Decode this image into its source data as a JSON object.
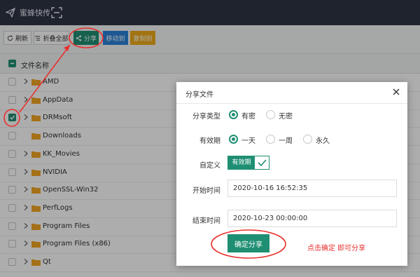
{
  "app": {
    "title": "蜜蜂快传"
  },
  "toolbar": {
    "refresh_label": "刷新",
    "collapse_label": "折叠全部",
    "share_label": "分享",
    "move_label": "移动到",
    "copy_label": "复制到"
  },
  "file_list": {
    "header": "文件名称",
    "rows": [
      {
        "name": "AMD",
        "checked": false,
        "expandable": true
      },
      {
        "name": "AppData",
        "checked": false,
        "expandable": true
      },
      {
        "name": "DRMsoft",
        "checked": true,
        "expandable": true
      },
      {
        "name": "Downloads",
        "checked": false,
        "expandable": false
      },
      {
        "name": "KK_Movies",
        "checked": false,
        "expandable": true
      },
      {
        "name": "NVIDIA",
        "checked": false,
        "expandable": true
      },
      {
        "name": "OpenSSL-Win32",
        "checked": false,
        "expandable": true
      },
      {
        "name": "PerfLogs",
        "checked": false,
        "expandable": true
      },
      {
        "name": "Program Files",
        "checked": false,
        "expandable": true
      },
      {
        "name": "Program Files (x86)",
        "checked": false,
        "expandable": true
      },
      {
        "name": "Qt",
        "checked": false,
        "expandable": true
      }
    ]
  },
  "dialog": {
    "title": "分享文件",
    "share_type": {
      "label": "分享类型",
      "options": [
        "有密",
        "无密"
      ],
      "selected": "有密"
    },
    "validity": {
      "label": "有效期",
      "options": [
        "一天",
        "一周",
        "永久"
      ],
      "selected": "一天"
    },
    "custom": {
      "label": "自定义",
      "toggle_label": "有效期",
      "enabled": true
    },
    "start_time": {
      "label": "开始时间",
      "value": "2020-10-16 16:52:35"
    },
    "end_time": {
      "label": "结束时间",
      "value": "2020-10-23 00:00:00"
    },
    "confirm_label": "确定分享"
  },
  "annotation": {
    "text": "点击确定 即可分享",
    "color": "#e8312f"
  },
  "colors": {
    "primary": "#1f8f73",
    "move": "#2a82d8",
    "copy": "#efac1a",
    "topbar": "#2e3444"
  }
}
